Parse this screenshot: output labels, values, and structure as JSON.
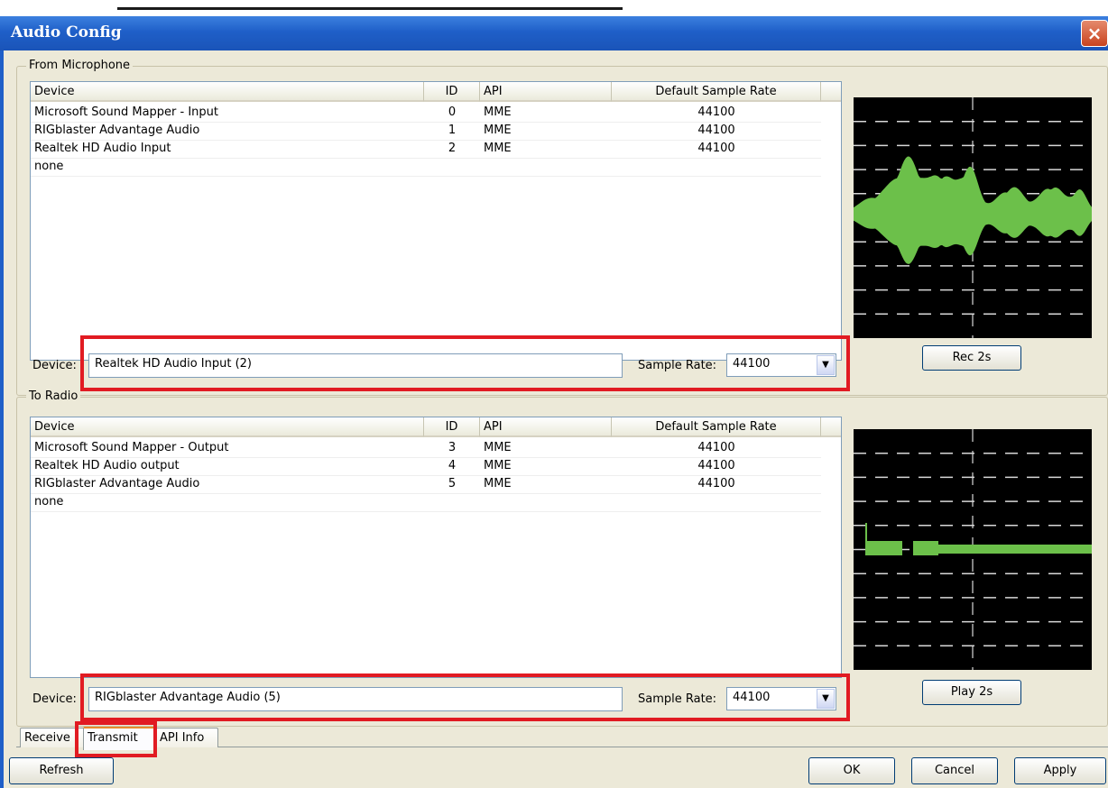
{
  "window": {
    "title": "Audio Config",
    "close_glyph": "×"
  },
  "columns": [
    "Device",
    "ID",
    "API",
    "Default Sample Rate"
  ],
  "from_microphone": {
    "legend": "From Microphone",
    "rows": [
      {
        "device": "Microsoft Sound Mapper - Input",
        "id": "0",
        "api": "MME",
        "rate": "44100"
      },
      {
        "device": "RIGblaster Advantage Audio",
        "id": "1",
        "api": "MME",
        "rate": "44100"
      },
      {
        "device": "Realtek HD Audio Input",
        "id": "2",
        "api": "MME",
        "rate": "44100"
      },
      {
        "device": "none",
        "id": "",
        "api": "",
        "rate": ""
      }
    ],
    "device_label": "Device:",
    "device_value": "Realtek HD Audio Input (2)",
    "rate_label": "Sample Rate:",
    "rate_value": "44100",
    "button": "Rec 2s"
  },
  "to_radio": {
    "legend": "To Radio",
    "rows": [
      {
        "device": "Microsoft Sound Mapper - Output",
        "id": "3",
        "api": "MME",
        "rate": "44100"
      },
      {
        "device": "Realtek HD Audio output",
        "id": "4",
        "api": "MME",
        "rate": "44100"
      },
      {
        "device": "RIGblaster Advantage Audio",
        "id": "5",
        "api": "MME",
        "rate": "44100"
      },
      {
        "device": "none",
        "id": "",
        "api": "",
        "rate": ""
      }
    ],
    "device_label": "Device:",
    "device_value": "RIGblaster Advantage Audio (5)",
    "rate_label": "Sample Rate:",
    "rate_value": "44100",
    "button": "Play 2s"
  },
  "tabs": [
    "Receive",
    "Transmit",
    "API Info"
  ],
  "active_tab": "Transmit",
  "footer": {
    "refresh": "Refresh",
    "ok": "OK",
    "cancel": "Cancel",
    "apply": "Apply"
  },
  "colors": {
    "highlight": "#e11b22",
    "waveform": "#6cc04a",
    "titlebar": "#1f5fc8"
  }
}
